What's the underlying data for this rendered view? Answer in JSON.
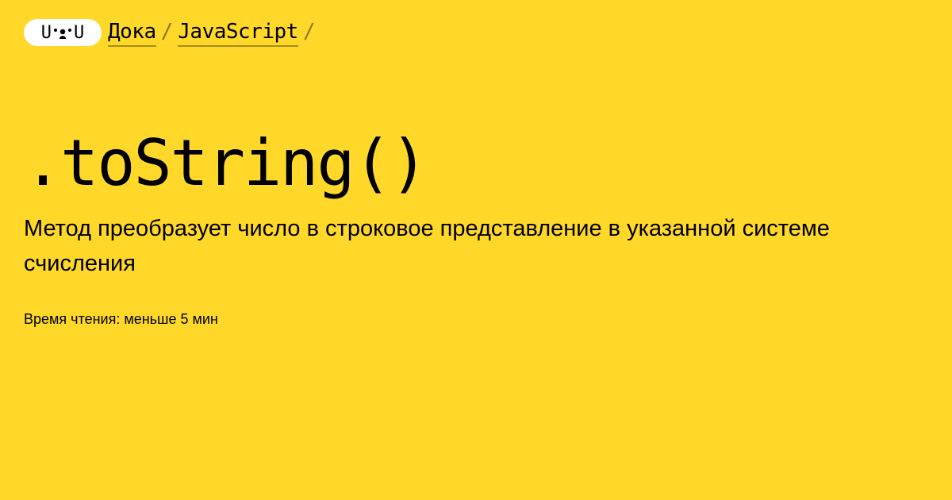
{
  "header": {
    "logo": {
      "left": "U",
      "right": "U",
      "icon": "doka-face-logo-icon"
    },
    "breadcrumbs": [
      {
        "label": "Дока"
      },
      {
        "label": "JavaScript"
      }
    ],
    "separator": "/"
  },
  "main": {
    "title": ".toString()",
    "description": "Метод преобразует число в строковое представление в указанной системе счисления",
    "reading_time": "Время чтения: меньше 5 мин"
  },
  "colors": {
    "background": "#FFD829",
    "text": "#000000",
    "logo_background": "#FFFFFF"
  }
}
